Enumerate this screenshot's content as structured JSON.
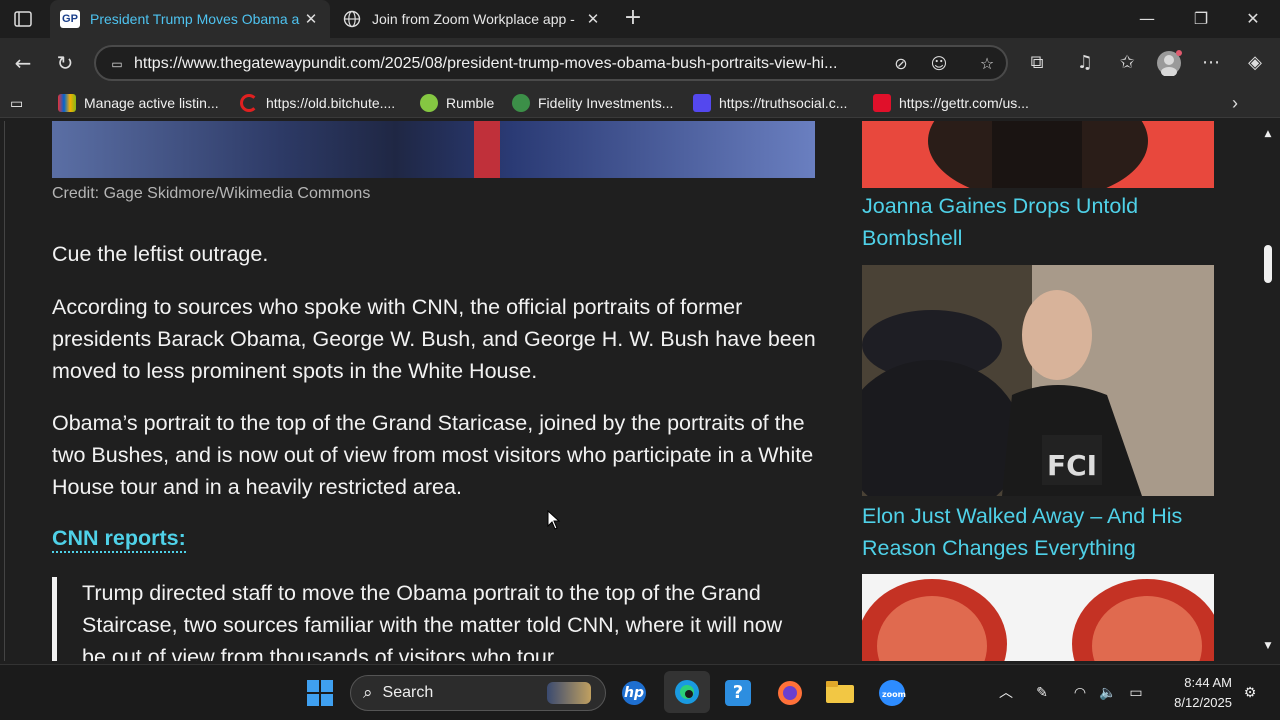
{
  "browser": {
    "tabs": [
      {
        "title": "President Trump Moves Obama a",
        "favicon": "GP",
        "active": true
      },
      {
        "title": "Join from Zoom Workplace app -",
        "favicon": "globe-icon",
        "active": false
      }
    ],
    "url": "https://www.thegatewaypundit.com/2025/08/president-trump-moves-obama-bush-portraits-view-hi...",
    "bookmarks": [
      "Manage active listin...",
      "https://old.bitchute....",
      "Rumble",
      "Fidelity Investments...",
      "https://truthsocial.c...",
      "https://gettr.com/us..."
    ]
  },
  "article": {
    "caption": "Credit: Gage Skidmore/Wikimedia Commons",
    "paragraphs": [
      "Cue the leftist outrage.",
      "According to sources who spoke with CNN, the official portraits of former presidents Barack Obama, George W. Bush, and George H. W. Bush have been moved to less prominent spots in the White House.",
      "Obama’s portrait to the top of the Grand Staricase, joined by the portraits of the two Bushes, and is now out of view from most visitors who participate in a White House tour and in a heavily restricted area."
    ],
    "source_link": "CNN reports:",
    "blockquote": "Trump directed staff to move the Obama portrait to the top of the Grand Staircase, two sources familiar with the matter told CNN, where it will now be out of view from thousands of visitors who tour"
  },
  "sidebar": {
    "links": [
      "Joanna Gaines Drops Untold Bombshell",
      "Elon Just Walked Away – And His Reason Changes Everything"
    ]
  },
  "taskbar": {
    "search_label": "Search",
    "time": "8:44 AM",
    "date": "8/12/2025"
  },
  "colors": {
    "accent_link": "#4fd1e8",
    "active_tab_text": "#4ec3f0",
    "background": "#1f1f1f"
  }
}
